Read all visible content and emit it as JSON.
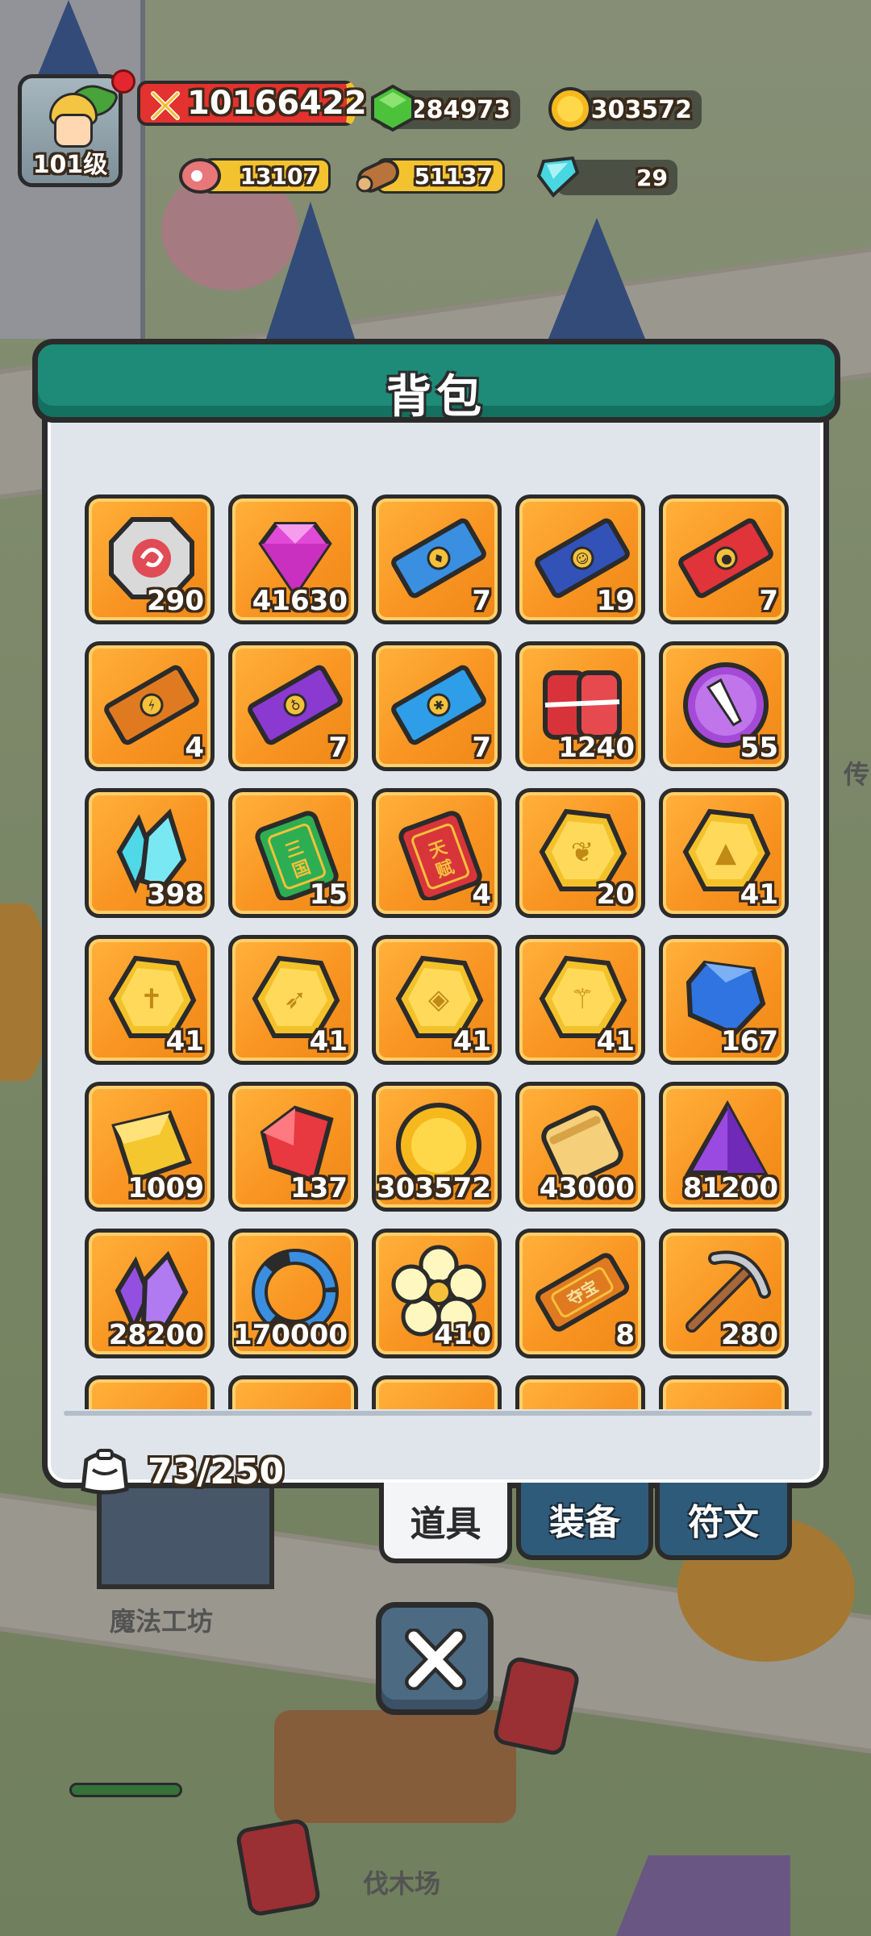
{
  "player": {
    "level_label": "101级",
    "power": "10166422"
  },
  "resources": [
    {
      "name": "green-gem",
      "value": "284973"
    },
    {
      "name": "gold-coin",
      "value": "303572"
    },
    {
      "name": "meat",
      "value": "13107"
    },
    {
      "name": "wood",
      "value": "51137"
    },
    {
      "name": "diamond",
      "value": "29"
    }
  ],
  "panel": {
    "title": "背包",
    "capacity": "73/250"
  },
  "items": [
    {
      "icon": "rune-stone-icon",
      "count": "290"
    },
    {
      "icon": "pink-gem-icon",
      "count": "41630"
    },
    {
      "icon": "blue-ticket-icon",
      "count": "7"
    },
    {
      "icon": "navy-ticket-icon",
      "count": "19"
    },
    {
      "icon": "red-ticket-icon",
      "count": "7"
    },
    {
      "icon": "orange-ticket-icon",
      "count": "4"
    },
    {
      "icon": "purple-ticket-icon",
      "count": "7"
    },
    {
      "icon": "sky-ticket-icon",
      "count": "7"
    },
    {
      "icon": "meat-bundle-icon",
      "count": "1240"
    },
    {
      "icon": "purple-orb-icon",
      "count": "55"
    },
    {
      "icon": "cyan-crystal-icon",
      "count": "398"
    },
    {
      "icon": "green-tag-icon",
      "count": "15",
      "tag_text": "三国"
    },
    {
      "icon": "red-tag-icon",
      "count": "4",
      "tag_text": "天赋"
    },
    {
      "icon": "gold-token-leaf-icon",
      "count": "20"
    },
    {
      "icon": "gold-token-hat-icon",
      "count": "41"
    },
    {
      "icon": "gold-token-sword-icon",
      "count": "41"
    },
    {
      "icon": "gold-token-bow-icon",
      "count": "41"
    },
    {
      "icon": "gold-token-shield-icon",
      "count": "41"
    },
    {
      "icon": "gold-token-staff-icon",
      "count": "41"
    },
    {
      "icon": "blue-gem-icon",
      "count": "167"
    },
    {
      "icon": "gold-ingot-icon",
      "count": "1009"
    },
    {
      "icon": "red-crystal-icon",
      "count": "137"
    },
    {
      "icon": "gold-coin-icon",
      "count": "303572"
    },
    {
      "icon": "scroll-icon",
      "count": "43000"
    },
    {
      "icon": "purple-prism-icon",
      "count": "81200"
    },
    {
      "icon": "purple-crystal-icon",
      "count": "28200"
    },
    {
      "icon": "ring-icon",
      "count": "170000"
    },
    {
      "icon": "flower-icon",
      "count": "410"
    },
    {
      "icon": "treasure-tag-icon",
      "count": "8",
      "tag_text": "夺宝"
    },
    {
      "icon": "pickaxe-icon",
      "count": "280"
    },
    {
      "icon": "partial-item-icon",
      "count": ""
    },
    {
      "icon": "partial-item-icon",
      "count": ""
    },
    {
      "icon": "partial-item-icon",
      "count": ""
    },
    {
      "icon": "partial-item-icon",
      "count": ""
    },
    {
      "icon": "partial-item-icon",
      "count": ""
    }
  ],
  "tabs": [
    {
      "label": "道具",
      "active": true
    },
    {
      "label": "装备",
      "active": false
    },
    {
      "label": "符文",
      "active": false
    }
  ],
  "scene": {
    "workshop": "魔法工坊",
    "lumberyard": "伐木场",
    "right_edge": "传"
  },
  "colors": {
    "slot": "#f99522",
    "header": "#1e8b78",
    "tab_inactive": "#2f5b7a",
    "panel": "#dfe5eb"
  }
}
